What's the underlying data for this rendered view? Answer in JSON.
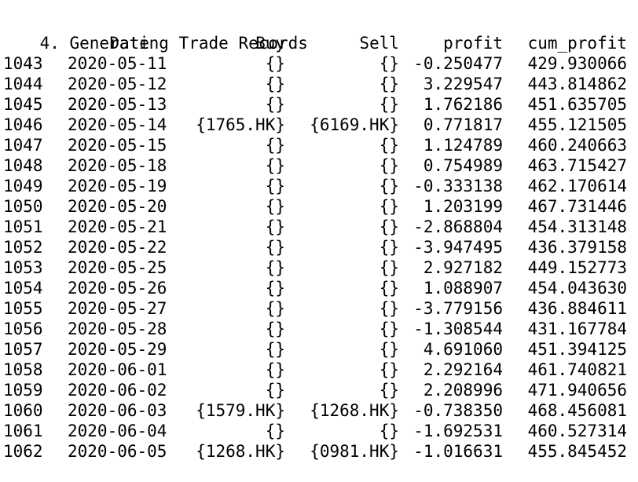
{
  "top_partial": "        ",
  "section_title": "4. Generating Trade Records",
  "columns": {
    "date": "Date",
    "buy": "Buy",
    "sell": "Sell",
    "profit": "profit",
    "cum_profit": "cum_profit"
  },
  "rows": [
    {
      "idx": "1043",
      "date": "2020-05-11",
      "buy": "{}",
      "sell": "{}",
      "profit": "-0.250477",
      "cum": "429.930066"
    },
    {
      "idx": "1044",
      "date": "2020-05-12",
      "buy": "{}",
      "sell": "{}",
      "profit": "3.229547",
      "cum": "443.814862"
    },
    {
      "idx": "1045",
      "date": "2020-05-13",
      "buy": "{}",
      "sell": "{}",
      "profit": "1.762186",
      "cum": "451.635705"
    },
    {
      "idx": "1046",
      "date": "2020-05-14",
      "buy": "{1765.HK}",
      "sell": "{6169.HK}",
      "profit": "0.771817",
      "cum": "455.121505"
    },
    {
      "idx": "1047",
      "date": "2020-05-15",
      "buy": "{}",
      "sell": "{}",
      "profit": "1.124789",
      "cum": "460.240663"
    },
    {
      "idx": "1048",
      "date": "2020-05-18",
      "buy": "{}",
      "sell": "{}",
      "profit": "0.754989",
      "cum": "463.715427"
    },
    {
      "idx": "1049",
      "date": "2020-05-19",
      "buy": "{}",
      "sell": "{}",
      "profit": "-0.333138",
      "cum": "462.170614"
    },
    {
      "idx": "1050",
      "date": "2020-05-20",
      "buy": "{}",
      "sell": "{}",
      "profit": "1.203199",
      "cum": "467.731446"
    },
    {
      "idx": "1051",
      "date": "2020-05-21",
      "buy": "{}",
      "sell": "{}",
      "profit": "-2.868804",
      "cum": "454.313148"
    },
    {
      "idx": "1052",
      "date": "2020-05-22",
      "buy": "{}",
      "sell": "{}",
      "profit": "-3.947495",
      "cum": "436.379158"
    },
    {
      "idx": "1053",
      "date": "2020-05-25",
      "buy": "{}",
      "sell": "{}",
      "profit": "2.927182",
      "cum": "449.152773"
    },
    {
      "idx": "1054",
      "date": "2020-05-26",
      "buy": "{}",
      "sell": "{}",
      "profit": "1.088907",
      "cum": "454.043630"
    },
    {
      "idx": "1055",
      "date": "2020-05-27",
      "buy": "{}",
      "sell": "{}",
      "profit": "-3.779156",
      "cum": "436.884611"
    },
    {
      "idx": "1056",
      "date": "2020-05-28",
      "buy": "{}",
      "sell": "{}",
      "profit": "-1.308544",
      "cum": "431.167784"
    },
    {
      "idx": "1057",
      "date": "2020-05-29",
      "buy": "{}",
      "sell": "{}",
      "profit": "4.691060",
      "cum": "451.394125"
    },
    {
      "idx": "1058",
      "date": "2020-06-01",
      "buy": "{}",
      "sell": "{}",
      "profit": "2.292164",
      "cum": "461.740821"
    },
    {
      "idx": "1059",
      "date": "2020-06-02",
      "buy": "{}",
      "sell": "{}",
      "profit": "2.208996",
      "cum": "471.940656"
    },
    {
      "idx": "1060",
      "date": "2020-06-03",
      "buy": "{1579.HK}",
      "sell": "{1268.HK}",
      "profit": "-0.738350",
      "cum": "468.456081"
    },
    {
      "idx": "1061",
      "date": "2020-06-04",
      "buy": "{}",
      "sell": "{}",
      "profit": "-1.692531",
      "cum": "460.527314"
    },
    {
      "idx": "1062",
      "date": "2020-06-05",
      "buy": "{1268.HK}",
      "sell": "{0981.HK}",
      "profit": "-1.016631",
      "cum": "455.845452"
    }
  ]
}
